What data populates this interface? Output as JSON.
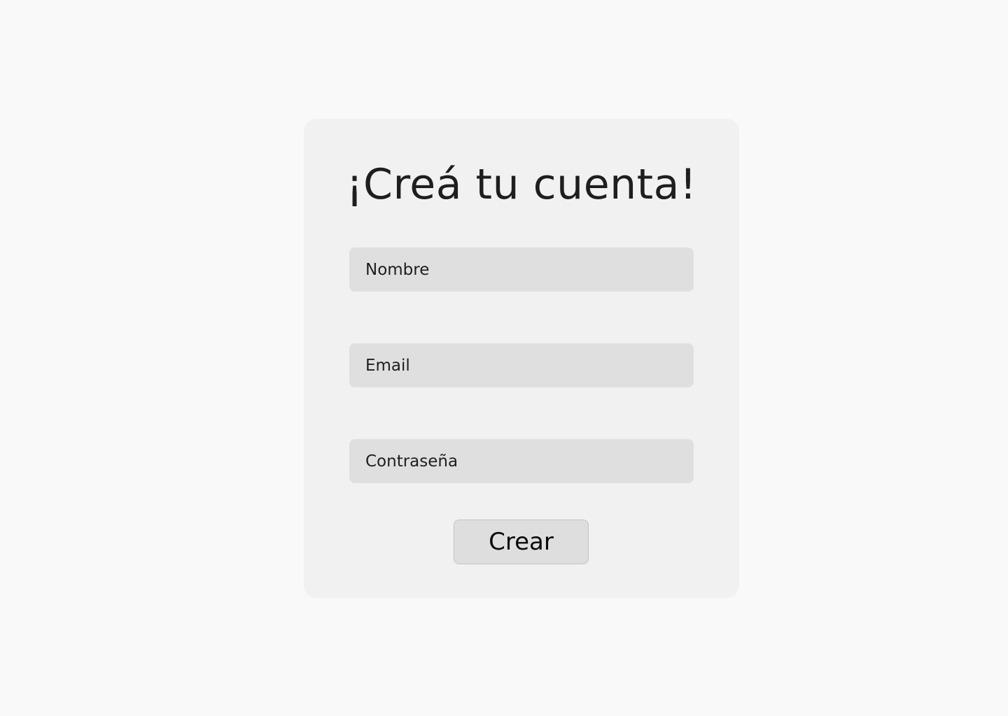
{
  "form": {
    "title": "¡Creá tu cuenta!",
    "fields": [
      {
        "placeholder": "Nombre",
        "value": ""
      },
      {
        "placeholder": "Email",
        "value": ""
      },
      {
        "placeholder": "Contraseña",
        "value": ""
      }
    ],
    "submit_label": "Crear"
  },
  "colors": {
    "page_background": "#f9f9f9",
    "card_background": "#f1f1f1",
    "input_background": "#dfdfdf",
    "button_background": "#dedede",
    "text": "#1e1e1e"
  }
}
